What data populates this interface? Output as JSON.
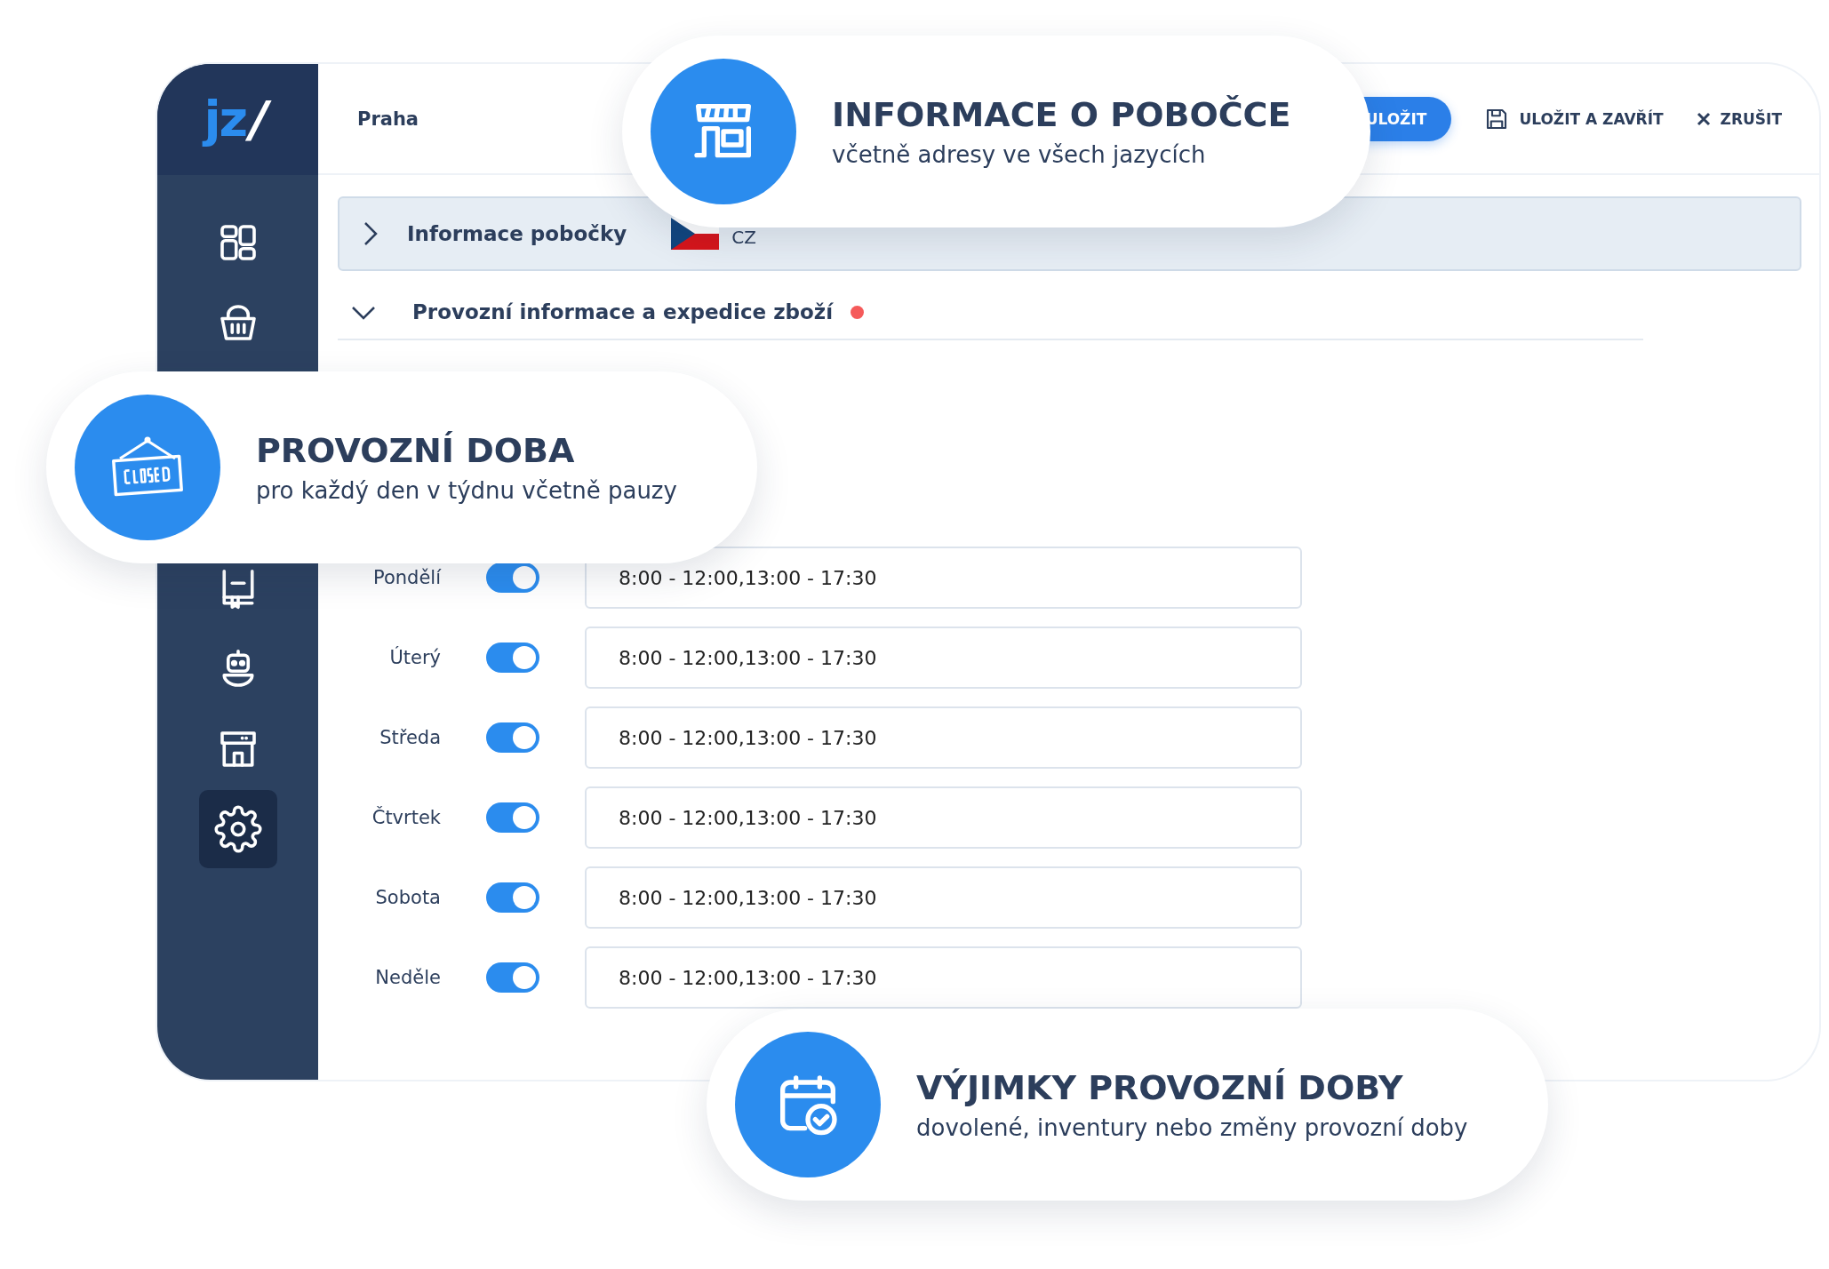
{
  "sidebar": {
    "logo": "jz",
    "logo_mark": "/",
    "items": [
      {
        "kind": "dashboard",
        "selected": false
      },
      {
        "kind": "basket",
        "selected": false
      },
      {
        "kind": "book",
        "selected": false
      },
      {
        "kind": "robot",
        "selected": false
      },
      {
        "kind": "store",
        "selected": false
      },
      {
        "kind": "gear",
        "selected": true
      }
    ]
  },
  "header": {
    "title": "Praha",
    "buttons": [
      {
        "label": "ULOŽIT",
        "kind": "primary"
      },
      {
        "label": "ULOŽIT A ZAVŘÍT",
        "kind": "save"
      },
      {
        "label": "ZRUŠIT",
        "kind": "cancel"
      }
    ]
  },
  "sections": [
    {
      "title": "Informace pobočky",
      "expanded": false,
      "language": "CZ",
      "alert": false
    },
    {
      "title": "Provozní informace a expedice zboží",
      "expanded": true,
      "alert": true
    }
  ],
  "hours": [
    {
      "day": "Pondělí",
      "on": true,
      "value": "8:00 - 12:00,13:00 - 17:30"
    },
    {
      "day": "Úterý",
      "on": true,
      "value": "8:00 - 12:00,13:00 - 17:30"
    },
    {
      "day": "Středa",
      "on": true,
      "value": "8:00 - 12:00,13:00 - 17:30"
    },
    {
      "day": "Čtvrtek",
      "on": true,
      "value": "8:00 - 12:00,13:00 - 17:30"
    },
    {
      "day": "Sobota",
      "on": true,
      "value": "8:00 - 12:00,13:00 - 17:30"
    },
    {
      "day": "Neděle",
      "on": true,
      "value": "8:00 - 12:00,13:00 - 17:30"
    }
  ],
  "callouts": [
    {
      "kind": "store",
      "title": "INFORMACE O POBOČCE",
      "subtitle": "včetně adresy ve všech jazycích"
    },
    {
      "kind": "closed-sign",
      "title": "PROVOZNÍ DOBA",
      "subtitle": "pro každý den v týdnu včetně pauzy"
    },
    {
      "kind": "calendar",
      "title": "VÝJIMKY PROVOZNÍ DOBY",
      "subtitle": "dovolené, inventury nebo změny provozní doby"
    }
  ]
}
